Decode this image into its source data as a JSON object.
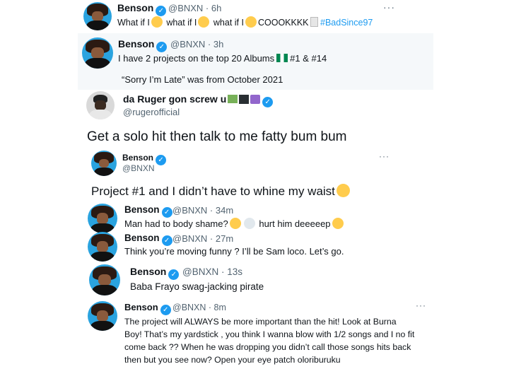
{
  "tweets": [
    {
      "name": "Benson",
      "handle": "@BNXN · 6h",
      "text_parts": [
        "What if I",
        "what if I",
        "what if I",
        "COOOKKKK",
        "#BadSince97"
      ]
    },
    {
      "name": "Benson",
      "handle": "@BNXN · 3h",
      "line1_a": "I have 2 projects on the top 20 Albums",
      "line1_b": "#1 & #14",
      "line2": "“Sorry I’m Late” was from October 2021"
    },
    {
      "name": "da Ruger gon screw u",
      "handle": "@rugerofficial",
      "text": "Get a solo hit then talk to me fatty bum bum"
    },
    {
      "name": "Benson",
      "handle": "@BNXN",
      "text": "Project #1 and I didn’t have to whine my waist"
    },
    {
      "name": "Benson",
      "handle": "@BNXN · 34m",
      "text_a": "Man had to body shame?",
      "text_b": "hurt him deeeeep"
    },
    {
      "name": "Benson",
      "handle": "@BNXN · 27m",
      "text": "Think you’re moving funny ? I’ll be Sam loco. Let’s go."
    },
    {
      "name": "Benson",
      "handle": "@BNXN · 13s",
      "text": "Baba Frayo swag-jacking pirate"
    },
    {
      "name": "Benson",
      "handle": "@BNXN · 8m",
      "lines": [
        "The project will ALWAYS be more important than the hit! Look at Burna",
        "Boy! That’s my yardstick , you think I wanna blow with 1/2 songs and I no fit",
        "come back ?? When he was dropping you didn’t call those songs hits back",
        "then but you see now? Open your eye patch oloriburuku"
      ]
    }
  ],
  "more_label": "···",
  "verified_glyph": "✓",
  "colors": {
    "accent": "#1d9bf0",
    "text": "#0f1419",
    "muted": "#536471"
  }
}
